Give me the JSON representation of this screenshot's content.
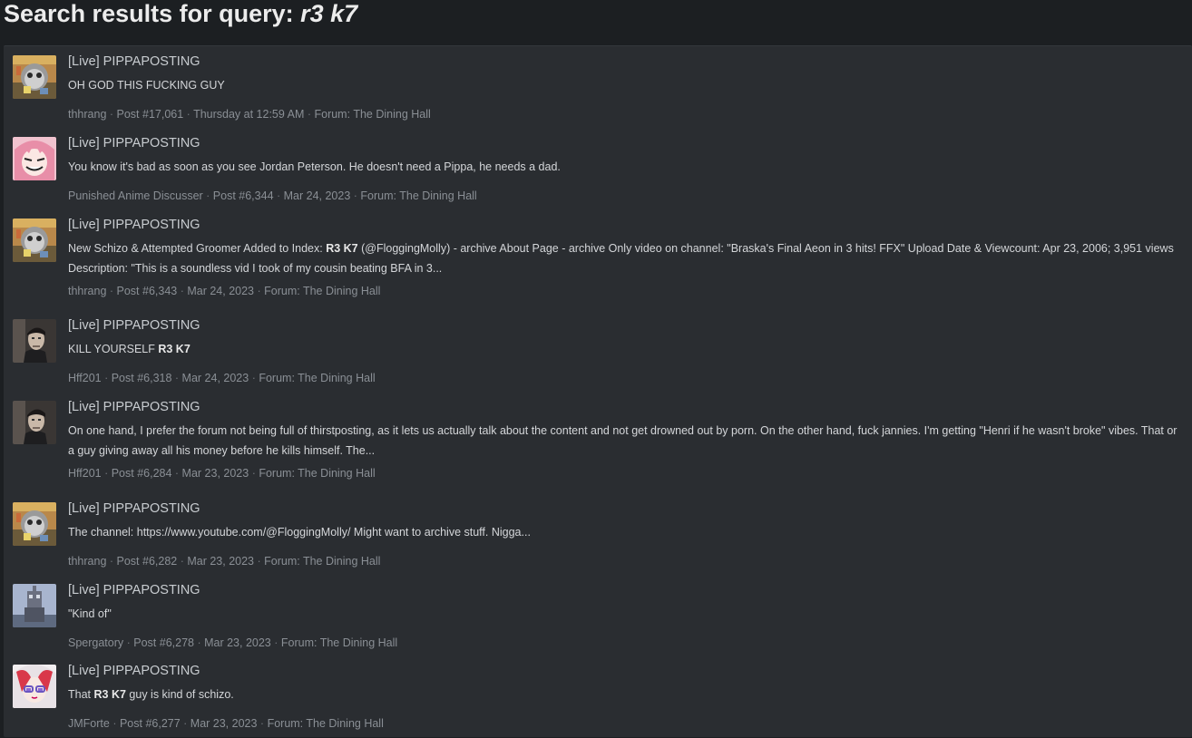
{
  "header": {
    "prefix": "Search results for query:",
    "query": "r3 k7"
  },
  "results": [
    {
      "title": "[Live] PIPPAPOSTING",
      "snippet_parts": [
        {
          "t": "OH GOD THIS FUCKING GUY",
          "b": false
        }
      ],
      "user": "thhrang",
      "post": "Post #17,061",
      "date": "Thursday at 12:59 AM",
      "forum": "Forum: The Dining Hall",
      "avatar": "avatar-thhrang"
    },
    {
      "title": "[Live] PIPPAPOSTING",
      "snippet_parts": [
        {
          "t": "You know it's bad as soon as you see Jordan Peterson. He doesn't need a Pippa, he needs a dad.",
          "b": false
        }
      ],
      "user": "Punished Anime Discusser",
      "post": "Post #6,344",
      "date": "Mar 24, 2023",
      "forum": "Forum: The Dining Hall",
      "avatar": "avatar-pink"
    },
    {
      "title": "[Live] PIPPAPOSTING",
      "snippet_parts": [
        {
          "t": "New Schizo & Attempted Groomer Added to Index: ",
          "b": false
        },
        {
          "t": "R3 K7",
          "b": true
        },
        {
          "t": " (@FloggingMolly) - archive About Page - archive Only video on channel: \"Braska's Final Aeon in 3 hits! FFX\" Upload Date & Viewcount: Apr 23, 2006; 3,951 views Description: \"This is a soundless vid I took of my cousin beating BFA in 3...",
          "b": false
        }
      ],
      "user": "thhrang",
      "post": "Post #6,343",
      "date": "Mar 24, 2023",
      "forum": "Forum: The Dining Hall",
      "avatar": "avatar-thhrang"
    },
    {
      "title": "[Live] PIPPAPOSTING",
      "snippet_parts": [
        {
          "t": "KILL YOURSELF ",
          "b": false
        },
        {
          "t": "R3 K7",
          "b": true
        }
      ],
      "user": "Hff201",
      "post": "Post #6,318",
      "date": "Mar 24, 2023",
      "forum": "Forum: The Dining Hall",
      "avatar": "avatar-man"
    },
    {
      "title": "[Live] PIPPAPOSTING",
      "snippet_parts": [
        {
          "t": "On one hand, I prefer the forum not being full of thirstposting, as it lets us actually talk about the content and not get drowned out by porn. On the other hand, fuck jannies. I'm getting \"Henri if he wasn't broke\" vibes. That or a guy giving away all his money before he kills himself. The...",
          "b": false
        }
      ],
      "user": "Hff201",
      "post": "Post #6,284",
      "date": "Mar 23, 2023",
      "forum": "Forum: The Dining Hall",
      "avatar": "avatar-man"
    },
    {
      "title": "[Live] PIPPAPOSTING",
      "snippet_parts": [
        {
          "t": "The channel: https://www.youtube.com/@FloggingMolly/ Might want to archive stuff. Nigga...",
          "b": false
        }
      ],
      "user": "thhrang",
      "post": "Post #6,282",
      "date": "Mar 23, 2023",
      "forum": "Forum: The Dining Hall",
      "avatar": "avatar-thhrang"
    },
    {
      "title": "[Live] PIPPAPOSTING",
      "snippet_parts": [
        {
          "t": "\"Kind of\"",
          "b": false
        }
      ],
      "user": "Spergatory",
      "post": "Post #6,278",
      "date": "Mar 23, 2023",
      "forum": "Forum: The Dining Hall",
      "avatar": "avatar-robot"
    },
    {
      "title": "[Live] PIPPAPOSTING",
      "snippet_parts": [
        {
          "t": "That ",
          "b": false
        },
        {
          "t": "R3 K7",
          "b": true
        },
        {
          "t": " guy is kind of schizo.",
          "b": false
        }
      ],
      "user": "JMForte",
      "post": "Post #6,277",
      "date": "Mar 23, 2023",
      "forum": "Forum: The Dining Hall",
      "avatar": "avatar-anime"
    }
  ]
}
